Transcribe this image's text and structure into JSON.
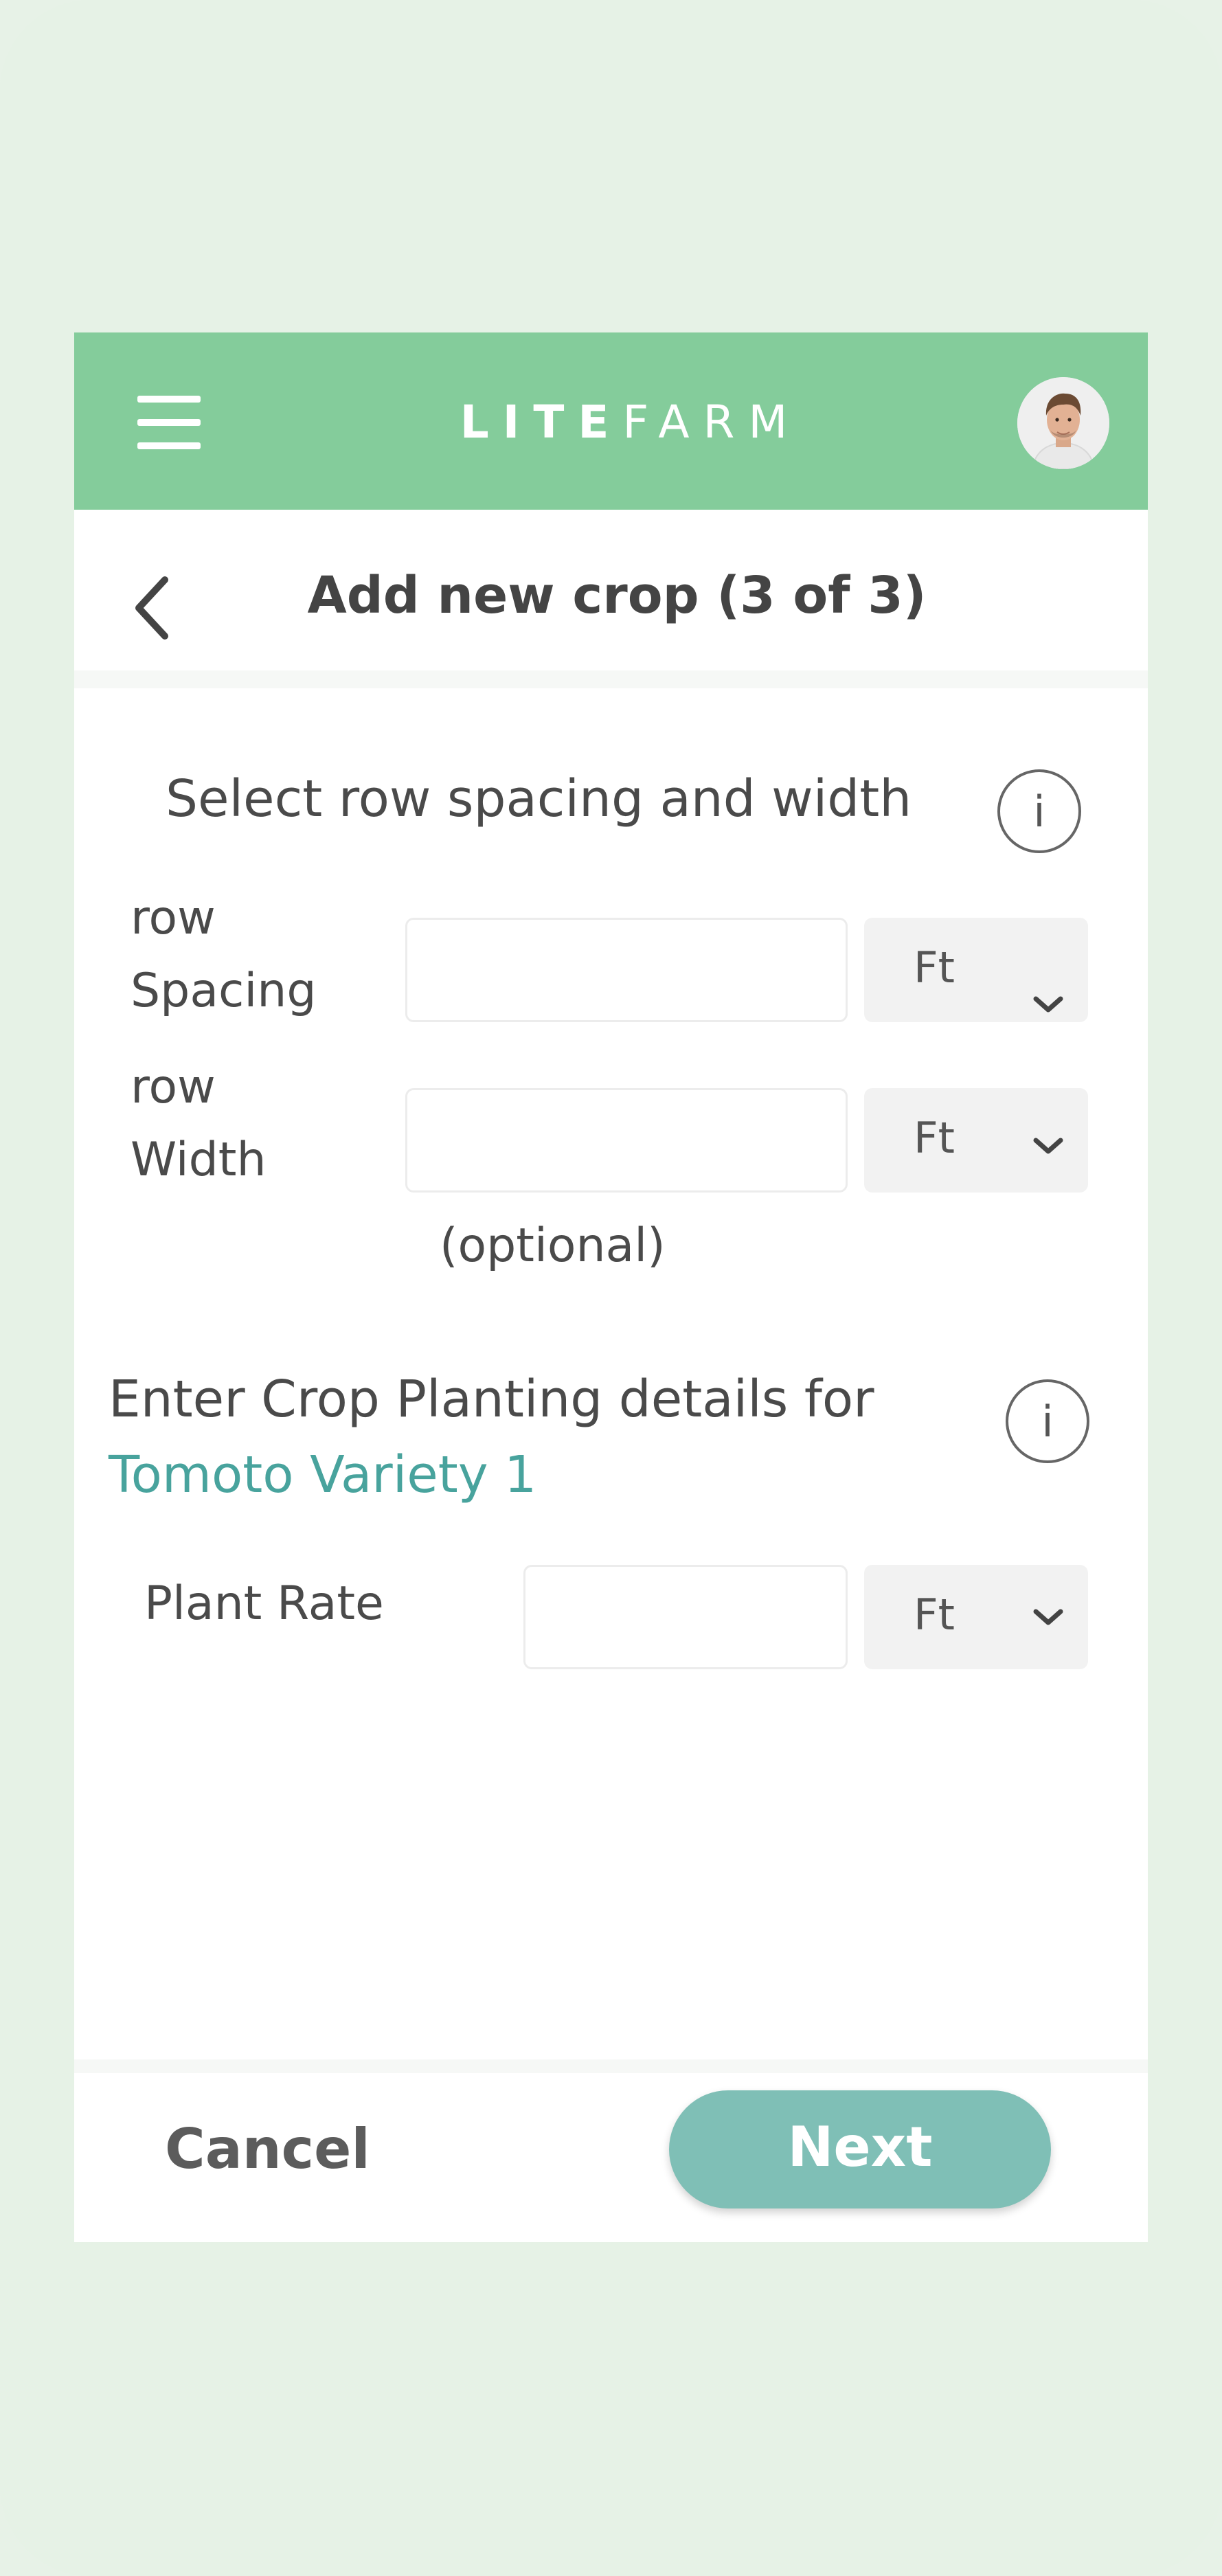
{
  "colors": {
    "header_green": "#84cc9b",
    "accent_teal": "#48a39d",
    "next_button": "#7fbfb6",
    "background": "#e7f2e7"
  },
  "header": {
    "logo_bold": "LITE",
    "logo_light": "FARM",
    "menu_icon": "hamburger-icon",
    "avatar_icon": "user-avatar"
  },
  "titlebar": {
    "back_icon": "chevron-left-icon",
    "title": "Add new crop (3 of 3)"
  },
  "row_section": {
    "heading": "Select row spacing and width",
    "info_icon_glyph": "i",
    "spacing": {
      "label_line1": "row",
      "label_line2": "Spacing",
      "value": "",
      "unit": "Ft"
    },
    "width": {
      "label_line1": "row",
      "label_line2": "Width",
      "value": "",
      "unit": "Ft",
      "hint": "(optional)"
    }
  },
  "planting_section": {
    "heading": "Enter Crop Planting details for",
    "crop_name": "Tomoto Variety 1",
    "info_icon_glyph": "i",
    "plant_rate": {
      "label": "Plant Rate",
      "value": "",
      "unit": "Ft"
    }
  },
  "footer": {
    "cancel_label": "Cancel",
    "next_label": "Next"
  }
}
